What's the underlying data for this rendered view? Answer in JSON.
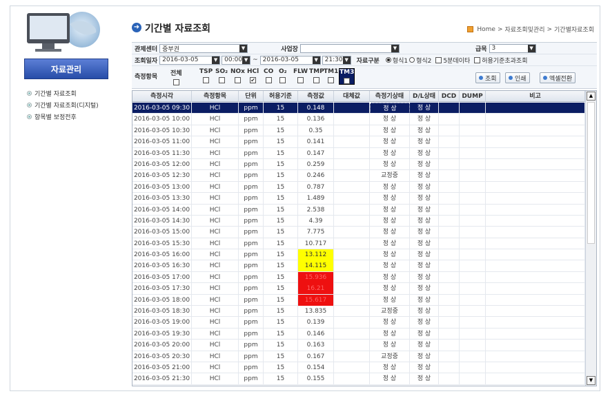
{
  "sidebar": {
    "banner": "자료관리",
    "items": [
      {
        "label": "기간별 자료조회"
      },
      {
        "label": "기간별 자료조회(디지털)"
      },
      {
        "label": "항목별 보정전후"
      }
    ]
  },
  "header": {
    "title": "기간별 자료조회",
    "breadcrumb": [
      "Home",
      ">",
      "자료조회및관리",
      ">",
      "기간별자료조회"
    ]
  },
  "filter": {
    "center_label": "관제센터",
    "center_value": "중부권",
    "site_label": "사업장",
    "site_value": "",
    "grade_label": "급목",
    "grade_value": "3",
    "date_label": "조회일자",
    "start_date": "2016-03-05",
    "start_time": "00:00",
    "range_sep": "~",
    "end_date": "2016-03-05",
    "end_time": "21:30",
    "type_label": "자료구분",
    "type_options": [
      {
        "label": "형식1",
        "checked": true
      },
      {
        "label": "형식2",
        "checked": false
      }
    ],
    "five_min_label": "5분데이타",
    "exceed_label": "허용기준초과조회",
    "items_label": "측정항목",
    "all_label": "전체",
    "items": [
      {
        "label": "TSP",
        "checked": false
      },
      {
        "label": "SO₂",
        "checked": false
      },
      {
        "label": "NOx",
        "checked": false
      },
      {
        "label": "HCl",
        "checked": true
      },
      {
        "label": "CO",
        "checked": false
      },
      {
        "label": "O₂",
        "checked": false
      },
      {
        "label": "FLW",
        "checked": false
      },
      {
        "label": "TMP",
        "checked": false
      },
      {
        "label": "TM1",
        "checked": false
      },
      {
        "label": "TM3",
        "checked": false
      }
    ],
    "buttons": {
      "search": "조회",
      "print": "인쇄",
      "excel": "엑셀전환"
    }
  },
  "table": {
    "columns": [
      "측정시각",
      "측정항목",
      "단위",
      "허용기준",
      "측정값",
      "대체값",
      "측정기상태",
      "D/L상태",
      "DCD",
      "DUMP",
      "비고"
    ],
    "rows": [
      {
        "time": "2016-03-05 09:30",
        "item": "HCl",
        "unit": "ppm",
        "limit": "15",
        "value": "0.148",
        "sub": "",
        "meter": "정 상",
        "dl": "정 상",
        "hl": "",
        "selected": true
      },
      {
        "time": "2016-03-05 10:00",
        "item": "HCl",
        "unit": "ppm",
        "limit": "15",
        "value": "0.136",
        "sub": "",
        "meter": "정 상",
        "dl": "정 상",
        "hl": ""
      },
      {
        "time": "2016-03-05 10:30",
        "item": "HCl",
        "unit": "ppm",
        "limit": "15",
        "value": "0.35",
        "sub": "",
        "meter": "정 상",
        "dl": "정 상",
        "hl": ""
      },
      {
        "time": "2016-03-05 11:00",
        "item": "HCl",
        "unit": "ppm",
        "limit": "15",
        "value": "0.141",
        "sub": "",
        "meter": "정 상",
        "dl": "정 상",
        "hl": ""
      },
      {
        "time": "2016-03-05 11:30",
        "item": "HCl",
        "unit": "ppm",
        "limit": "15",
        "value": "0.147",
        "sub": "",
        "meter": "정 상",
        "dl": "정 상",
        "hl": ""
      },
      {
        "time": "2016-03-05 12:00",
        "item": "HCl",
        "unit": "ppm",
        "limit": "15",
        "value": "0.259",
        "sub": "",
        "meter": "정 상",
        "dl": "정 상",
        "hl": ""
      },
      {
        "time": "2016-03-05 12:30",
        "item": "HCl",
        "unit": "ppm",
        "limit": "15",
        "value": "0.246",
        "sub": "",
        "meter": "교정중",
        "dl": "정 상",
        "hl": ""
      },
      {
        "time": "2016-03-05 13:00",
        "item": "HCl",
        "unit": "ppm",
        "limit": "15",
        "value": "0.787",
        "sub": "",
        "meter": "정 상",
        "dl": "정 상",
        "hl": ""
      },
      {
        "time": "2016-03-05 13:30",
        "item": "HCl",
        "unit": "ppm",
        "limit": "15",
        "value": "1.489",
        "sub": "",
        "meter": "정 상",
        "dl": "정 상",
        "hl": ""
      },
      {
        "time": "2016-03-05 14:00",
        "item": "HCl",
        "unit": "ppm",
        "limit": "15",
        "value": "2.538",
        "sub": "",
        "meter": "정 상",
        "dl": "정 상",
        "hl": ""
      },
      {
        "time": "2016-03-05 14:30",
        "item": "HCl",
        "unit": "ppm",
        "limit": "15",
        "value": "4.39",
        "sub": "",
        "meter": "정 상",
        "dl": "정 상",
        "hl": ""
      },
      {
        "time": "2016-03-05 15:00",
        "item": "HCl",
        "unit": "ppm",
        "limit": "15",
        "value": "7.775",
        "sub": "",
        "meter": "정 상",
        "dl": "정 상",
        "hl": ""
      },
      {
        "time": "2016-03-05 15:30",
        "item": "HCl",
        "unit": "ppm",
        "limit": "15",
        "value": "10.717",
        "sub": "",
        "meter": "정 상",
        "dl": "정 상",
        "hl": ""
      },
      {
        "time": "2016-03-05 16:00",
        "item": "HCl",
        "unit": "ppm",
        "limit": "15",
        "value": "13.112",
        "sub": "",
        "meter": "정 상",
        "dl": "정 상",
        "hl": "yellow"
      },
      {
        "time": "2016-03-05 16:30",
        "item": "HCl",
        "unit": "ppm",
        "limit": "15",
        "value": "14.115",
        "sub": "",
        "meter": "정 상",
        "dl": "정 상",
        "hl": "yellow"
      },
      {
        "time": "2016-03-05 17:00",
        "item": "HCl",
        "unit": "ppm",
        "limit": "15",
        "value": "15.936",
        "sub": "",
        "meter": "정 상",
        "dl": "정 상",
        "hl": "red"
      },
      {
        "time": "2016-03-05 17:30",
        "item": "HCl",
        "unit": "ppm",
        "limit": "15",
        "value": "16.21",
        "sub": "",
        "meter": "정 상",
        "dl": "정 상",
        "hl": "red"
      },
      {
        "time": "2016-03-05 18:00",
        "item": "HCl",
        "unit": "ppm",
        "limit": "15",
        "value": "15.617",
        "sub": "",
        "meter": "정 상",
        "dl": "정 상",
        "hl": "red"
      },
      {
        "time": "2016-03-05 18:30",
        "item": "HCl",
        "unit": "ppm",
        "limit": "15",
        "value": "13.835",
        "sub": "",
        "meter": "교정중",
        "dl": "정 상",
        "hl": ""
      },
      {
        "time": "2016-03-05 19:00",
        "item": "HCl",
        "unit": "ppm",
        "limit": "15",
        "value": "0.139",
        "sub": "",
        "meter": "정 상",
        "dl": "정 상",
        "hl": ""
      },
      {
        "time": "2016-03-05 19:30",
        "item": "HCl",
        "unit": "ppm",
        "limit": "15",
        "value": "0.146",
        "sub": "",
        "meter": "정 상",
        "dl": "정 상",
        "hl": ""
      },
      {
        "time": "2016-03-05 20:00",
        "item": "HCl",
        "unit": "ppm",
        "limit": "15",
        "value": "0.163",
        "sub": "",
        "meter": "정 상",
        "dl": "정 상",
        "hl": ""
      },
      {
        "time": "2016-03-05 20:30",
        "item": "HCl",
        "unit": "ppm",
        "limit": "15",
        "value": "0.167",
        "sub": "",
        "meter": "교정중",
        "dl": "정 상",
        "hl": ""
      },
      {
        "time": "2016-03-05 21:00",
        "item": "HCl",
        "unit": "ppm",
        "limit": "15",
        "value": "0.154",
        "sub": "",
        "meter": "정 상",
        "dl": "정 상",
        "hl": ""
      },
      {
        "time": "2016-03-05 21:30",
        "item": "HCl",
        "unit": "ppm",
        "limit": "15",
        "value": "0.155",
        "sub": "",
        "meter": "정 상",
        "dl": "정 상",
        "hl": ""
      }
    ]
  },
  "colors": {
    "selected_row": "#0b1d63",
    "highlight_yellow": "#ffff00",
    "highlight_red": "#ee1010",
    "banner": "#3a5fc0",
    "title_icon": "#2a63b8"
  }
}
